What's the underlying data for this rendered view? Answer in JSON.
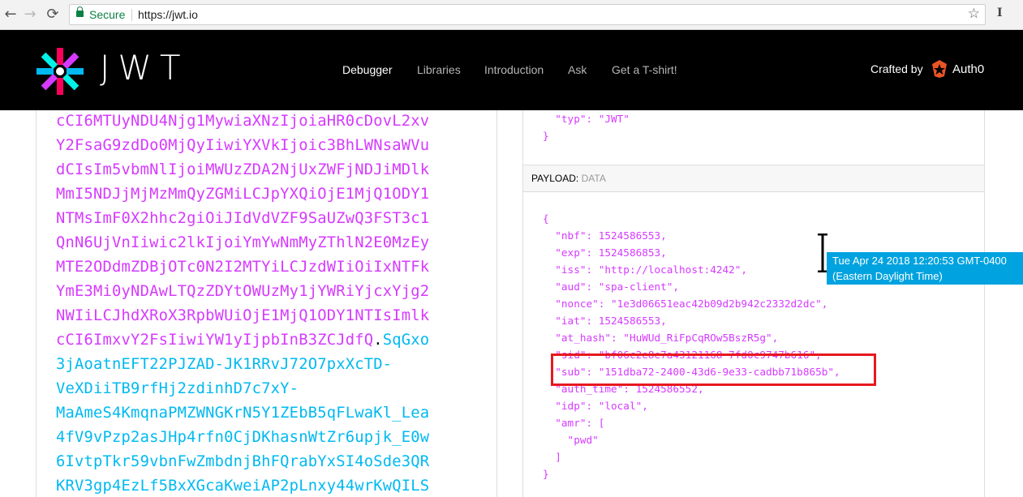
{
  "browser": {
    "back_icon": "←",
    "forward_icon": "→",
    "reload_icon": "⟳",
    "secure_label": "Secure",
    "url": "https://jwt.io",
    "star_icon": "☆",
    "extension_label": "I"
  },
  "header": {
    "logo_text": "JWT",
    "nav": [
      "Debugger",
      "Libraries",
      "Introduction",
      "Ask",
      "Get a T-shirt!"
    ],
    "active_nav": "Debugger",
    "crafted_by": "Crafted by",
    "brand": "Auth0"
  },
  "encoded": {
    "payload_lines": [
      "cCI6MTUyNDU4Njg1MywiaXNzIjoiaHR0cDovL2xv",
      "Y2FsaG9zdDo0MjQyIiwiYXVkIjoic3BhLWNsaWVu",
      "dCIsIm5vbmNlIjoiMWUzZDA2NjUxZWFjNDJiMDlk",
      "MmI5NDJjMjMzMmQyZGMiLCJpYXQiOjE1MjQ1ODY1",
      "NTMsImF0X2hhc2giOiJIdVdVZF9SaUZwQ3FST3c1",
      "QnN6UjVnIiwic2lkIjoiYmYwNmMyZThlN2E0MzEy",
      "MTE2ODdmZDBjOTc0N2I2MTYiLCJzdWIiOiIxNTFk",
      "YmE3Mi0yNDAwLTQzZDYtOWUzMy1jYWRiYjcxYjg2",
      "NWIiLCJhdXRoX3RpbWUiOjE1MjQ1ODY1NTIsImlk",
      "cCI6ImxvY2FsIiwiYW1yIjpbInB3ZCJdfQ"
    ],
    "dot": ".",
    "signature_first": "SqGxo",
    "signature_lines": [
      "3jAoatnEFT22PJZAD-JK1RRvJ72O7pxXcTD-",
      "VeXDiiTB9rfHj2zdinhD7c7xY-",
      "MaAmeS4KmqnaPMZWNGKrN5Y1ZEbB5qFLwaKl_Lea",
      "4fV9vPzp2asJHp4rfn0CjDKhasnWtZr6upjk_E0w",
      "6IvtpTkr59vbnFwZmbdnjBhFQrabYxSI4oSde3QR",
      "KRV3gp4EzLf5BxXGcaKweiAP2pLnxy44wrKwQILS"
    ]
  },
  "decoded": {
    "header_tail": [
      "  \"typ\": \"JWT\"",
      "}"
    ],
    "payload_label": "PAYLOAD:",
    "payload_sub": "DATA",
    "payload_lines": [
      "{",
      "  \"nbf\": 1524586553,",
      "  \"exp\": 1524586853,",
      "  \"iss\": \"http://localhost:4242\",",
      "  \"aud\": \"spa-client\",",
      "  \"nonce\": \"1e3d06651eac42b09d2b942c2332d2dc\",",
      "  \"iat\": 1524586553,",
      "  \"at_hash\": \"HuWUd_RiFpCqROw5BszR5g\",",
      "  \"sid\": \"bf06c2e8e7a43121168 7fd0c9747b616\",",
      "  \"sub\": \"151dba72-2400-43d6-9e33-cadbb71b865b\",",
      "  \"auth_time\": 1524586552,",
      "  \"idp\": \"local\",",
      "  \"amr\": [",
      "    \"pwd\"",
      "  ]",
      "}"
    ]
  },
  "tooltip": {
    "line1": "Tue Apr 24 2018 12:20:53 GMT-0400",
    "line2": "(Eastern Daylight Time)"
  },
  "colors": {
    "payload": "#d63aff",
    "signature": "#00b9f1",
    "highlight": "#e8181e",
    "tooltip_bg": "#00a3df"
  }
}
